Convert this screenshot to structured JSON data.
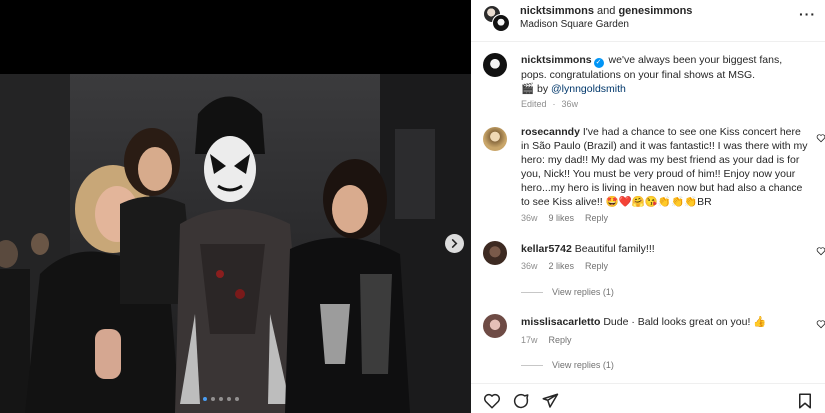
{
  "post": {
    "header": {
      "user1": "nicktsimmons",
      "joiner": "and",
      "user2": "genesimmons",
      "location": "Madison Square Garden"
    },
    "caption": {
      "username": "nicktsimmons",
      "text": "we've always been your biggest fans, pops. congratulations on your final shows at MSG.",
      "credit_prefix": "🎬 by",
      "credit_handle": "@lynngoldsmith",
      "edited": "Edited",
      "time": "36w"
    },
    "comments": [
      {
        "username": "rosecanndy",
        "text": "I've had a chance to see one Kiss concert here in São Paulo (Brazil) and it was fantastic!! I was there with my hero: my dad!! My dad was my best friend as your dad is for you, Nick!! You must be very proud of him!! Enjoy now your hero...my hero is living in heaven now but had also a chance to see Kiss alive!! 🤩❤️🤗😘👏👏👏BR",
        "time": "36w",
        "likes": "9 likes",
        "reply": "Reply"
      },
      {
        "username": "kellar5742",
        "text": "Beautiful family!!!",
        "time": "36w",
        "likes": "2 likes",
        "reply": "Reply",
        "view_replies": "View replies (1)"
      },
      {
        "username": "misslisacarletto",
        "text": "Dude · Bald looks great on you! 👍",
        "time": "17w",
        "reply": "Reply",
        "view_replies": "View replies (1)"
      }
    ],
    "carousel": {
      "count": 5,
      "active_index": 0
    }
  },
  "icons": {
    "like": "heart-icon",
    "comment": "comment-icon",
    "share": "share-icon",
    "save": "bookmark-icon",
    "next": "chevron-right-icon",
    "more": "more-icon"
  },
  "colors": {
    "link": "#00376b",
    "verified": "#0095f6",
    "muted": "#737373",
    "dot_active": "#4a9df2"
  }
}
